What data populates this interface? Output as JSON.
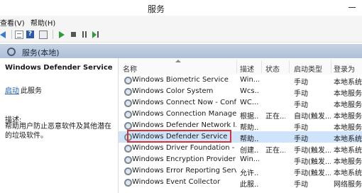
{
  "window": {
    "title": "服务"
  },
  "menu": {
    "view": "查看(V)",
    "help": "帮助(H)"
  },
  "toolbar": {
    "icons": [
      "back-icon",
      "show-hide-tree-icon",
      "help-icon",
      "console-icon",
      "start-service-icon",
      "stop-service-icon",
      "pause-service-icon",
      "restart-service-icon"
    ]
  },
  "pane": {
    "title": "服务(本地)"
  },
  "detail": {
    "service_name": "Windows Defender Service",
    "start_link": "启动",
    "start_suffix": "此服务",
    "description_label": "描述:",
    "description": "帮助用户防止恶意软件及其他潜在的垃圾软件。"
  },
  "table": {
    "columns": {
      "name": "名称",
      "description": "描述",
      "status": "状态",
      "startup": "启动类型",
      "logon": "登录为"
    },
    "rows": [
      {
        "name": "Windows Biometric Service",
        "description": "Win...",
        "status": "",
        "startup": "手动",
        "logon": "本地系统"
      },
      {
        "name": "Windows Color System",
        "description": "Wcs...",
        "status": "",
        "startup": "手动",
        "logon": "本地服务"
      },
      {
        "name": "Windows Connect Now - Confi...",
        "description": "WC...",
        "status": "",
        "startup": "手动",
        "logon": "本地服务"
      },
      {
        "name": "Windows Connection Manager",
        "description": "根据...",
        "status": "正在...",
        "startup": "自动(触发...",
        "logon": "本地服务"
      },
      {
        "name": "Windows Defender Network I...",
        "description": "帮助...",
        "status": "",
        "startup": "手动",
        "logon": "本地服务"
      },
      {
        "name": "Windows Defender Service",
        "description": "帮助...",
        "status": "",
        "startup": "手动",
        "logon": "本地系统",
        "selected": true
      },
      {
        "name": "Windows Driver Foundation - ...",
        "description": "创建...",
        "status": "正在...",
        "startup": "手动(触发...",
        "logon": "本地系统"
      },
      {
        "name": "Windows Encryption Provider ...",
        "description": "Win...",
        "status": "",
        "startup": "手动(触发...",
        "logon": "本地服务"
      },
      {
        "name": "Windows Error Reporting Servi...",
        "description": "允许...",
        "status": "",
        "startup": "手动(触发...",
        "logon": "本地系统"
      },
      {
        "name": "Windows Event Collector",
        "description": "此服...",
        "status": "",
        "startup": "手动",
        "logon": "网络服务"
      }
    ]
  },
  "colors": {
    "selection": "#cfe3fa",
    "highlight_box": "#d13438",
    "link": "#1a5fb4",
    "pane_header": "#b8c8dc"
  }
}
